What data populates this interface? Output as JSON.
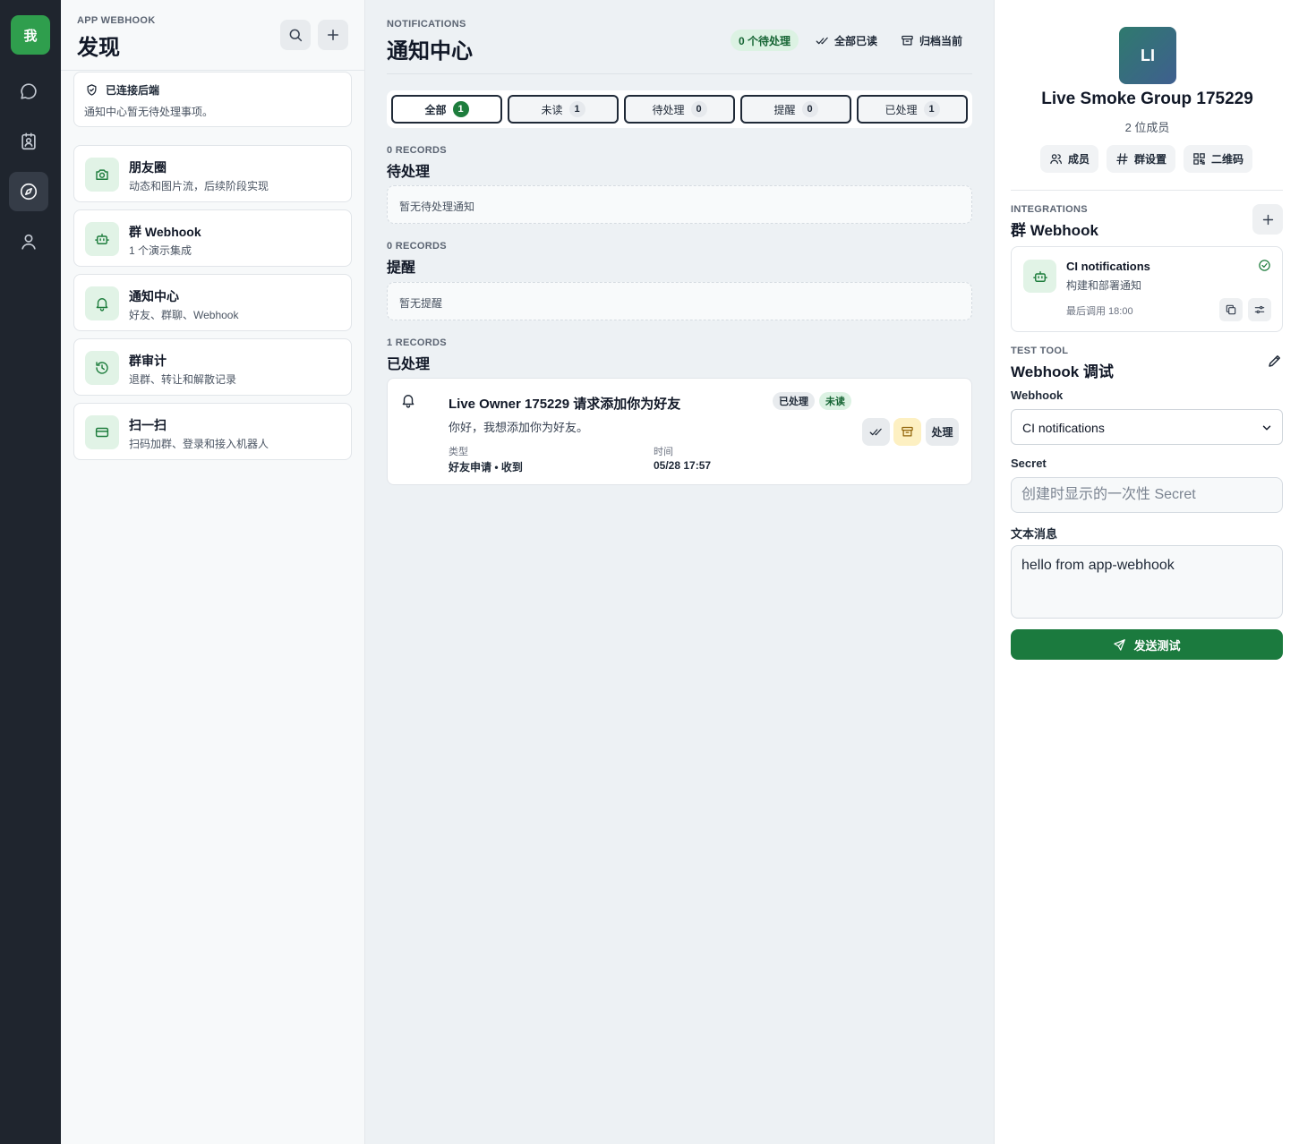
{
  "rail": {
    "me_label": "我",
    "items": [
      {
        "icon": "chat-bubble-icon"
      },
      {
        "icon": "contacts-book-icon"
      },
      {
        "icon": "compass-icon",
        "active": true
      },
      {
        "icon": "user-icon"
      }
    ]
  },
  "sidebar": {
    "eyebrow": "APP WEBHOOK",
    "title": "发现",
    "status": {
      "title": "已连接后端",
      "text": "通知中心暂无待处理事项。"
    },
    "items": [
      {
        "title": "朋友圈",
        "subtitle": "动态和图片流，后续阶段实现",
        "icon": "camera-icon"
      },
      {
        "title": "群 Webhook",
        "subtitle": "1 个演示集成",
        "icon": "robot-icon"
      },
      {
        "title": "通知中心",
        "subtitle": "好友、群聊、Webhook",
        "icon": "bell-icon"
      },
      {
        "title": "群审计",
        "subtitle": "退群、转让和解散记录",
        "icon": "history-icon"
      },
      {
        "title": "扫一扫",
        "subtitle": "扫码加群、登录和接入机器人",
        "icon": "card-scan-icon"
      }
    ]
  },
  "main": {
    "eyebrow": "NOTIFICATIONS",
    "title": "通知中心",
    "pending_pill": "0 个待处理",
    "mark_all_read": "全部已读",
    "archive_current": "归档当前",
    "tabs": [
      {
        "label": "全部",
        "count": "1",
        "active": true
      },
      {
        "label": "未读",
        "count": "1"
      },
      {
        "label": "待处理",
        "count": "0"
      },
      {
        "label": "提醒",
        "count": "0"
      },
      {
        "label": "已处理",
        "count": "1"
      }
    ],
    "sections": {
      "pending": {
        "eyebrow": "0 RECORDS",
        "title": "待处理",
        "empty": "暂无待处理通知"
      },
      "reminders": {
        "eyebrow": "0 RECORDS",
        "title": "提醒",
        "empty": "暂无提醒"
      },
      "processed": {
        "eyebrow": "1 RECORDS",
        "title": "已处理"
      }
    },
    "notification": {
      "title": "Live Owner 175229 请求添加你为好友",
      "badge_processed": "已处理",
      "badge_unread": "未读",
      "body": "你好，我想添加你为好友。",
      "type_label": "类型",
      "type_value": "好友申请 • 收到",
      "time_label": "时间",
      "time_value": "05/28 17:57",
      "handle_label": "处理"
    }
  },
  "panel": {
    "avatar_initials": "LI",
    "group_name": "Live Smoke Group 175229",
    "member_count": "2 位成员",
    "buttons": {
      "members": "成员",
      "settings": "群设置",
      "qrcode": "二维码"
    },
    "integrations": {
      "eyebrow": "INTEGRATIONS",
      "title": "群 Webhook",
      "item": {
        "name": "CI notifications",
        "desc": "构建和部署通知",
        "last_call": "最后调用 18:00"
      }
    },
    "test_tool": {
      "eyebrow": "TEST TOOL",
      "title": "Webhook 调试",
      "webhook_label": "Webhook",
      "webhook_selected": "CI notifications",
      "secret_label": "Secret",
      "secret_placeholder": "创建时显示的一次性 Secret",
      "message_label": "文本消息",
      "message_value": "hello from app-webhook",
      "send_label": "发送测试"
    }
  },
  "colors": {
    "accent": "#1b7a3e",
    "rail_bg": "#1f252e",
    "icon_tint_bg": "#e1f3e6",
    "warning_bg": "#fdf0c2"
  }
}
